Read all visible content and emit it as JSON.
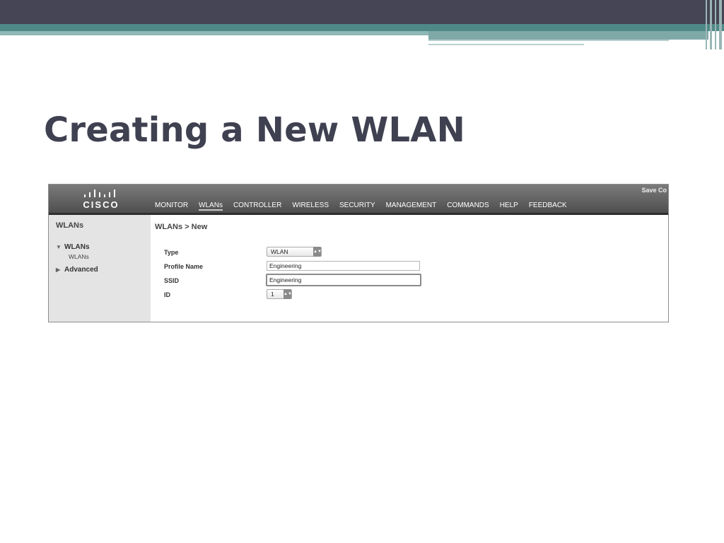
{
  "slide": {
    "title": "Creating a New WLAN"
  },
  "cisco": {
    "logo_text": "CISCO",
    "save_link": "Save Co",
    "nav": [
      "MONITOR",
      "WLANs",
      "CONTROLLER",
      "WIRELESS",
      "SECURITY",
      "MANAGEMENT",
      "COMMANDS",
      "HELP",
      "FEEDBACK"
    ],
    "active_nav": "WLANs"
  },
  "sidebar": {
    "title": "WLANs",
    "tree": [
      {
        "label": "WLANs",
        "expanded": true,
        "children": [
          "WLANs"
        ]
      },
      {
        "label": "Advanced",
        "expanded": false
      }
    ]
  },
  "main": {
    "breadcrumb": "WLANs > New",
    "fields": {
      "type": {
        "label": "Type",
        "value": "WLAN"
      },
      "profile_name": {
        "label": "Profile Name",
        "value": "Engineering"
      },
      "ssid": {
        "label": "SSID",
        "value": "Engineering"
      },
      "id": {
        "label": "ID",
        "value": "1"
      }
    }
  },
  "colors": {
    "slide_top_bar": "#454555",
    "slide_teal": "#4e8987",
    "title_text": "#3f4151",
    "cisco_header": "#5a5a5a",
    "sidebar_bg": "#e4e4e4"
  }
}
